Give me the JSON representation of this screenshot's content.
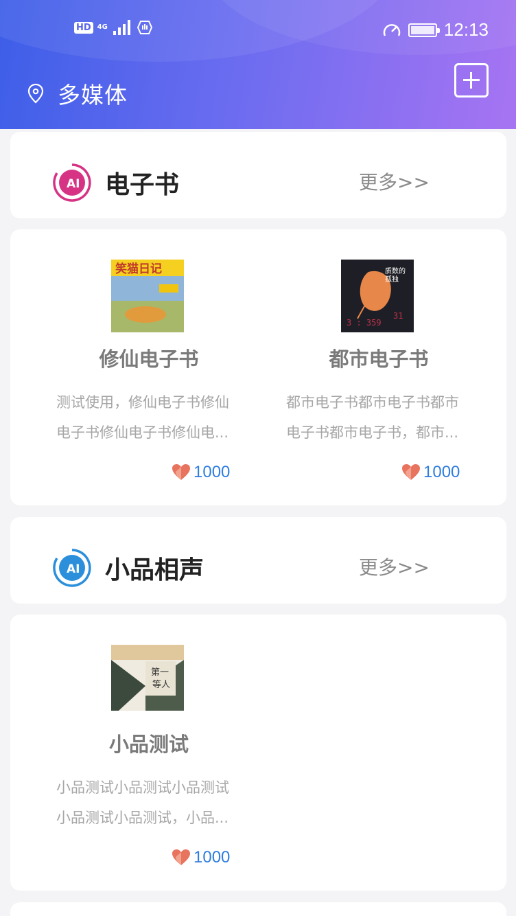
{
  "status_bar": {
    "left_badge": "HD",
    "network": "4G",
    "time": "12:13"
  },
  "header": {
    "location_title": "多媒体"
  },
  "sections": [
    {
      "title": "电子书",
      "more": "更多>>",
      "logo_color": "#d63384",
      "items": [
        {
          "title": "修仙电子书",
          "desc_line1": "测试使用，修仙电子书修仙",
          "desc_line2": "电子书修仙电子书修仙电...",
          "likes": "1000",
          "cover_text": "笑猫日记"
        },
        {
          "title": "都市电子书",
          "desc_line1": "都市电子书都市电子书都市",
          "desc_line2": "电子书都市电子书，都市...",
          "likes": "1000",
          "cover_text": "质数的孤独"
        }
      ]
    },
    {
      "title": "小品相声",
      "more": "更多>>",
      "logo_color": "#2b8fdb",
      "items": [
        {
          "title": "小品测试",
          "desc_line1": "小品测试小品测试小品测试",
          "desc_line2": "小品测试小品测试，小品...",
          "likes": "1000",
          "cover_text": "第一等人"
        }
      ]
    }
  ],
  "colors": {
    "header_start": "#3d5ee8",
    "header_end": "#a774f2",
    "likes": "#2f7de0",
    "heart": "#e8735e"
  }
}
